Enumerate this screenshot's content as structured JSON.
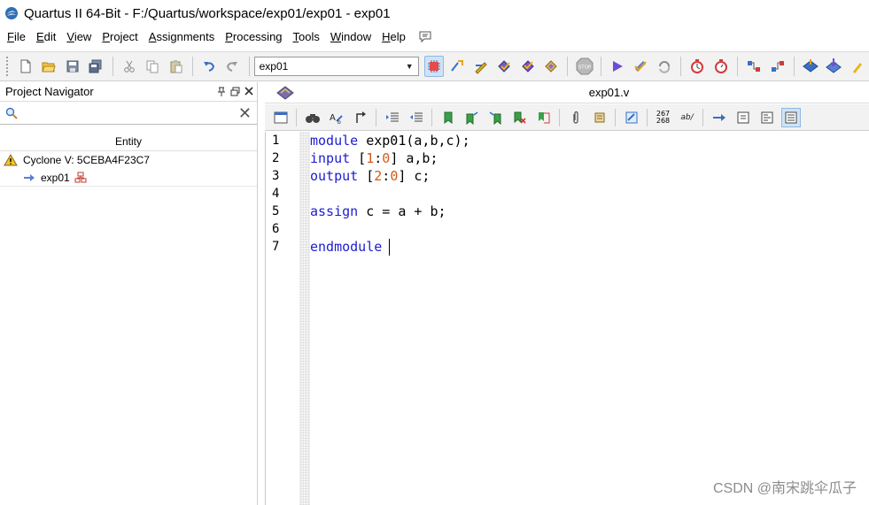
{
  "window": {
    "title": "Quartus II 64-Bit - F:/Quartus/workspace/exp01/exp01 - exp01"
  },
  "menu": [
    {
      "label": "File",
      "u": "F",
      "rest": "ile"
    },
    {
      "label": "Edit",
      "u": "E",
      "rest": "dit"
    },
    {
      "label": "View",
      "u": "V",
      "rest": "iew"
    },
    {
      "label": "Project",
      "u": "P",
      "rest": "roject"
    },
    {
      "label": "Assignments",
      "u": "A",
      "rest": "ssignments"
    },
    {
      "label": "Processing",
      "u": "P",
      "rest": "rocessing"
    },
    {
      "label": "Tools",
      "u": "T",
      "rest": "ools"
    },
    {
      "label": "Window",
      "u": "W",
      "rest": "indow"
    },
    {
      "label": "Help",
      "u": "H",
      "rest": "elp"
    }
  ],
  "toolbar": {
    "revision_value": "exp01"
  },
  "navigator": {
    "title": "Project Navigator",
    "search_placeholder": "",
    "column_header": "Entity",
    "device": "Cyclone V: 5CEBA4F23C7",
    "top_entity": "exp01"
  },
  "editor": {
    "filename": "exp01.v",
    "line_numbers": [
      "1",
      "2",
      "3",
      "4",
      "5",
      "6",
      "7"
    ],
    "lines": {
      "l1": {
        "kw": "module",
        "rest": " exp01(a,b,c);"
      },
      "l2": {
        "kw": "input",
        "b1": " [",
        "n1": "1",
        "c": ":",
        "n2": "0",
        "b2": "]",
        "rest": " a,b;"
      },
      "l3": {
        "kw": "output",
        "b1": " [",
        "n1": "2",
        "c": ":",
        "n2": "0",
        "b2": "]",
        "rest": " c;"
      },
      "l5": {
        "kw": "assign",
        "rest": " c = a + b;"
      },
      "l7": {
        "kw": "endmodule"
      }
    },
    "toolbar_numbers": {
      "top": "267",
      "bottom": "268"
    },
    "toolbar_ab": "ab/"
  },
  "watermark": "CSDN @南宋跳伞瓜子",
  "colors": {
    "keyword": "#1d1dcf",
    "number": "#d25a17",
    "toolbar_bg": "#f2f2f2"
  }
}
